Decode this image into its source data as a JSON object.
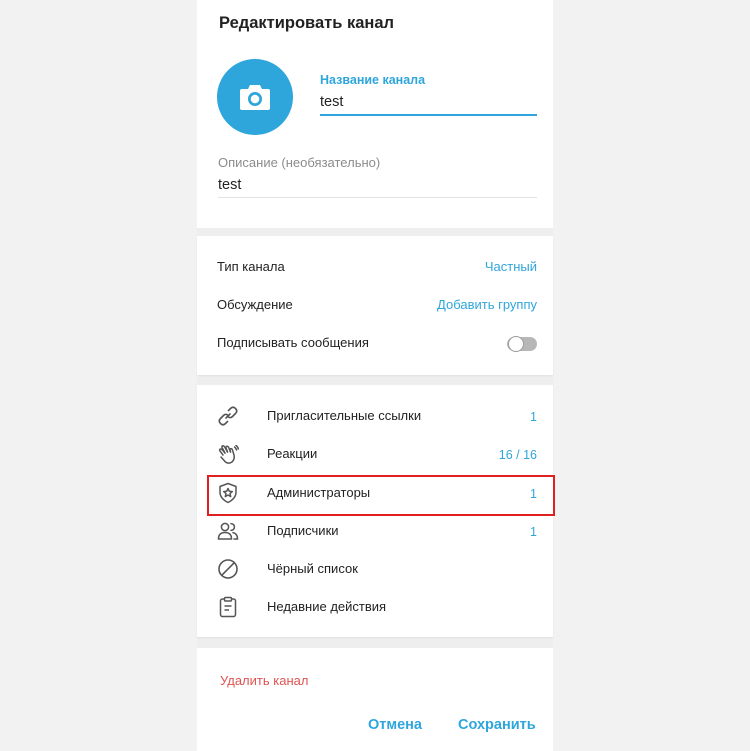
{
  "dialog": {
    "title": "Редактировать канал"
  },
  "channel": {
    "name_label": "Название канала",
    "name_value": "test",
    "description_label": "Описание (необязательно)",
    "description_value": "test"
  },
  "settings": [
    {
      "label": "Тип канала",
      "value": "Частный"
    },
    {
      "label": "Обсуждение",
      "value": "Добавить группу"
    },
    {
      "label": "Подписывать сообщения",
      "toggle": false
    }
  ],
  "list": [
    {
      "icon": "link-icon",
      "label": "Пригласительные ссылки",
      "value": "1"
    },
    {
      "icon": "reactions-hand-icon",
      "label": "Реакции",
      "value": "16 / 16"
    },
    {
      "icon": "admin-shield-star-icon",
      "label": "Администраторы",
      "value": "1",
      "highlighted": true
    },
    {
      "icon": "subscribers-icon",
      "label": "Подписчики",
      "value": "1"
    },
    {
      "icon": "blocked-icon",
      "label": "Чёрный список",
      "value": ""
    },
    {
      "icon": "recent-actions-clipboard-icon",
      "label": "Недавние действия",
      "value": ""
    }
  ],
  "actions": {
    "delete": "Удалить канал",
    "cancel": "Отмена",
    "save": "Сохранить"
  },
  "colors": {
    "accent": "#2ea6dc",
    "danger": "#e05353",
    "highlight_border": "#e02020"
  }
}
